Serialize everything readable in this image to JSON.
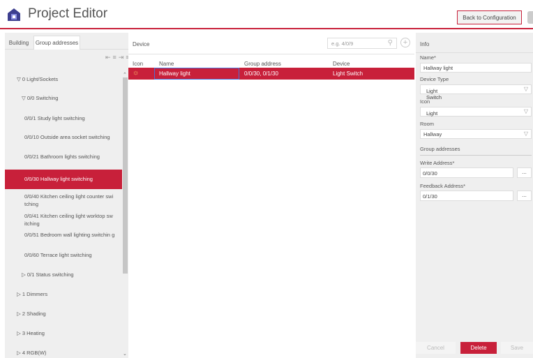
{
  "header": {
    "title": "Project Editor",
    "back_label": "Back to Configuration"
  },
  "left": {
    "tabs": [
      "Building",
      "Group addresses"
    ],
    "tree": [
      {
        "label": "▽ 0 Light/Sockets"
      },
      {
        "label": "▽ 0/0 Switching"
      },
      {
        "label": "0/0/1 Study light switching"
      },
      {
        "label": "0/0/10 Outside area socket switching"
      },
      {
        "label": "0/0/21 Bathroom lights switching"
      },
      {
        "label": "0/0/30 Hallway light switching"
      },
      {
        "label": "0/0/40 Kitchen ceiling light counter swi tching"
      },
      {
        "label": "0/0/41 Kitchen ceiling light worktop sw itching"
      },
      {
        "label": "0/0/51 Bedroom wall lighting switchin g"
      },
      {
        "label": "0/0/60 Terrace light switching"
      },
      {
        "label": "▷ 0/1 Status switching"
      },
      {
        "label": "▷ 1 Dimmers"
      },
      {
        "label": "▷ 2 Shading"
      },
      {
        "label": "▷ 3 Heating"
      },
      {
        "label": "▷ 4 RGB(W)"
      }
    ]
  },
  "center": {
    "title": "Device",
    "search_placeholder": "e.g. 4/0/9",
    "columns": [
      "Icon",
      "Name",
      "Group address",
      "Device"
    ],
    "row": {
      "name": "Hallway light",
      "group_address": "0/0/30, 0/1/30",
      "device": "Light Switch"
    }
  },
  "info": {
    "title": "Info",
    "name_label": "Name*",
    "name_value": "Hallway light",
    "device_type_label": "Device Type",
    "device_type_value": "Light Switch",
    "icon_label": "Icon",
    "icon_value": "Light",
    "room_label": "Room",
    "room_value": "Hallway",
    "group_addresses_label": "Group addresses",
    "write_label": "Write Address*",
    "write_value": "0/0/30",
    "feedback_label": "Feedback Address*",
    "feedback_value": "0/1/30",
    "dots": "...",
    "buttons": {
      "cancel": "Cancel",
      "delete": "Delete",
      "save": "Save"
    }
  },
  "colors": {
    "accent": "#c8203a",
    "panel": "#efefef"
  }
}
